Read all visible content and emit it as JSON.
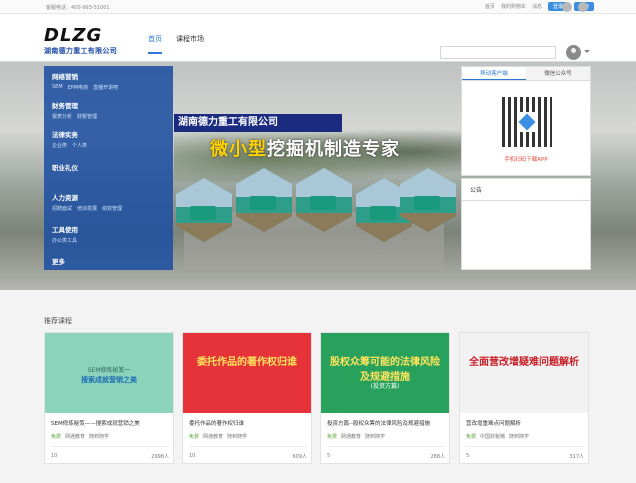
{
  "topbar": {
    "hotline": "客服电话：400-993-51001",
    "links": [
      "首页",
      "我的购物车",
      "消息"
    ],
    "login": "登录",
    "register": "注册"
  },
  "header": {
    "logo_mark": "DLZG",
    "logo_cn": "湖南德力重工有限公司",
    "nav": [
      "首页",
      "课程市场"
    ],
    "search_placeholder": ""
  },
  "categories": [
    {
      "title": "网络营销",
      "subs": [
        "SEM",
        "EPM电商",
        "直播开讲吧"
      ]
    },
    {
      "title": "财务管理",
      "subs": [
        "报表分析",
        "财税管理"
      ]
    },
    {
      "title": "法律实务",
      "subs": [
        "企业类",
        "个人类"
      ]
    },
    {
      "title": "职业礼仪",
      "subs": []
    },
    {
      "title": "人力资源",
      "subs": [
        "招聘面试",
        "培训发展",
        "绩效管理"
      ]
    },
    {
      "title": "工具使用",
      "subs": [
        "办公类工具"
      ]
    },
    {
      "title": "更多",
      "subs": []
    }
  ],
  "banner": {
    "company": "湖南德力重工有限公司",
    "slogan_pre": "微小型",
    "slogan_post": "挖掘机制造专家"
  },
  "side_panel": {
    "tabs": [
      "移动客户端",
      "微信公众号"
    ],
    "app_text": "手机扫码下载APP",
    "notice_title": "公告"
  },
  "section_title": "推荐课程",
  "courses": [
    {
      "title": "SEM修炼秘笈——搜索成就营销之美",
      "price": "免费",
      "org": "网通教育",
      "tag": "随到随学",
      "lessons": "10",
      "students": "2998人",
      "img_text": "搜索成就营销之美",
      "img_sub": "SEM修炼秘笈一",
      "img_color": "#8cd3bb"
    },
    {
      "title": "委托作品的著作权归谁",
      "price": "免费",
      "org": "网通教育",
      "tag": "随到随学",
      "lessons": "10",
      "students": "609人",
      "img_text": "委托作品的著作权归谁",
      "img_sub": "",
      "img_color": "#e6333a"
    },
    {
      "title": "投资方篇--股权众筹的法律风险及规避措施",
      "price": "免费",
      "org": "网通教育",
      "tag": "随到随学",
      "lessons": "5",
      "students": "288人",
      "img_text": "股权众筹可能的法律风险及规避措施",
      "img_sub": "(投资方篇)",
      "img_color": "#27a15b"
    },
    {
      "title": "营改增重难点问题解析",
      "price": "免费",
      "org": "中国财税稽",
      "tag": "随到随学",
      "lessons": "5",
      "students": "317人",
      "img_text": "全面营改增疑难问题解析",
      "img_sub": "",
      "img_color": "#f2f2f2"
    }
  ]
}
